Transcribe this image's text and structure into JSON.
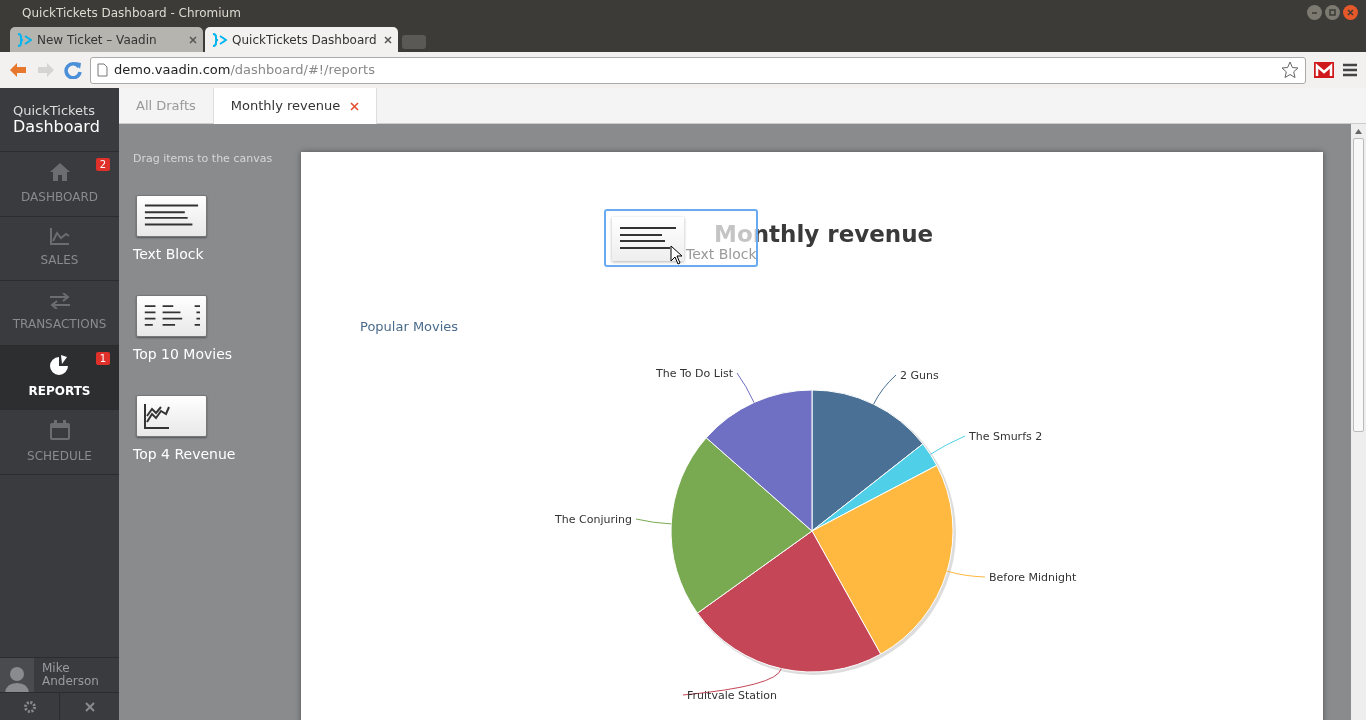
{
  "window": {
    "title": "QuickTickets Dashboard - Chromium"
  },
  "browser_tabs": [
    {
      "label": "New Ticket – Vaadin",
      "selected": false
    },
    {
      "label": "QuickTickets Dashboard",
      "selected": true
    }
  ],
  "address_bar": {
    "host": "demo.vaadin.com",
    "path": "/dashboard/#!/reports"
  },
  "app": {
    "title_top": "QuickTickets",
    "title_bottom": "Dashboard"
  },
  "sidebar": {
    "items": [
      {
        "kind": "home",
        "label": "DASHBOARD",
        "badge": "2",
        "selected": false
      },
      {
        "kind": "sales",
        "label": "SALES",
        "selected": false
      },
      {
        "kind": "transactions",
        "label": "TRANSACTIONS",
        "selected": false
      },
      {
        "kind": "reports",
        "label": "REPORTS",
        "badge": "1",
        "selected": true
      },
      {
        "kind": "schedule",
        "label": "SCHEDULE",
        "selected": false
      }
    ],
    "user": {
      "first": "Mike",
      "last": "Anderson"
    }
  },
  "tabs": [
    {
      "label": "All Drafts",
      "selected": false,
      "closable": false
    },
    {
      "label": "Monthly revenue",
      "selected": true,
      "closable": true
    }
  ],
  "palette": {
    "hint": "Drag items to the canvas",
    "items": [
      {
        "kind": "text",
        "label": "Text Block"
      },
      {
        "kind": "table",
        "label": "Top 10 Movies"
      },
      {
        "kind": "chart",
        "label": "Top 4 Revenue"
      }
    ]
  },
  "canvas": {
    "title": "Monthly revenue",
    "drag_preview": {
      "label": "Text Block"
    },
    "chart_title": "Popular Movies",
    "chart_data": {
      "type": "pie",
      "categories": [
        "2 Guns",
        "The Smurfs 2",
        "Before Midnight",
        "Fruitvale Station",
        "The Conjuring",
        "The To Do List"
      ],
      "values": [
        14.4,
        2.9,
        24.6,
        23.2,
        21.4,
        13.5
      ],
      "colors": [
        "#4a7095",
        "#4fd0e8",
        "#ffb840",
        "#c44657",
        "#79aa52",
        "#6f6fc4"
      ]
    }
  }
}
